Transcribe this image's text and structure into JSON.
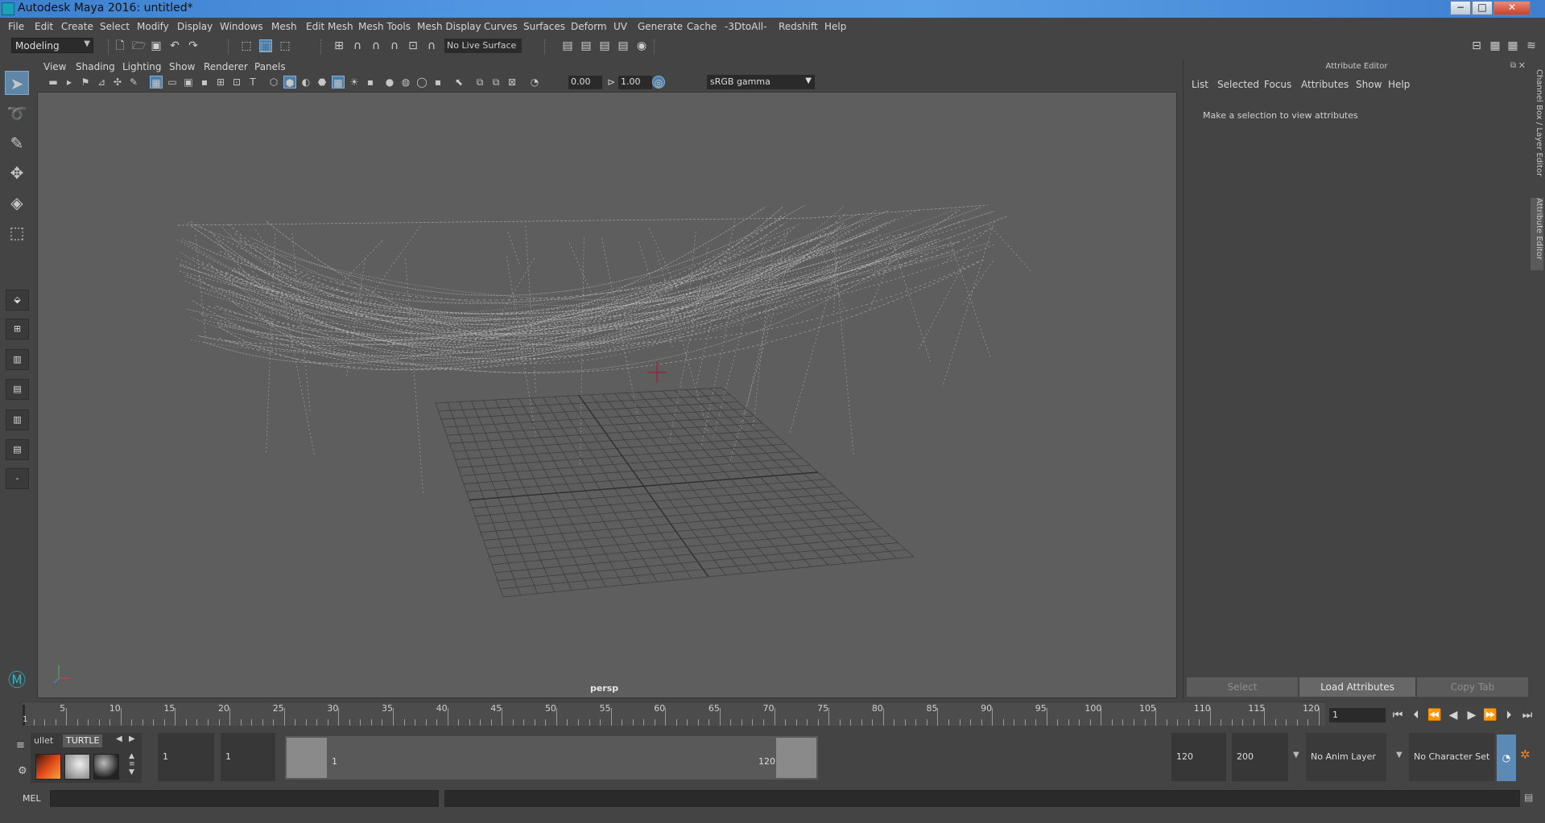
{
  "window": {
    "title": "Autodesk Maya 2016: untitled*",
    "min": "−",
    "max": "□",
    "close": "✕"
  },
  "menus": [
    "File",
    "Edit",
    "Create",
    "Select",
    "Modify",
    "Display",
    "Windows",
    "Mesh",
    "Edit Mesh",
    "Mesh Tools",
    "Mesh Display",
    "Curves",
    "Surfaces",
    "Deform",
    "UV",
    "Generate",
    "Cache",
    "-3DtoAll-",
    "Redshift",
    "Help"
  ],
  "status": {
    "mode": "Modeling",
    "live_surface": "No Live Surface"
  },
  "panel": {
    "menus": [
      "View",
      "Shading",
      "Lighting",
      "Show",
      "Renderer",
      "Panels"
    ],
    "exposure": "0.00",
    "gamma_value": "1.00",
    "color_space": "sRGB gamma",
    "camera": "persp"
  },
  "attribute_editor": {
    "header": "Attribute Editor",
    "menus": [
      "List",
      "Selected",
      "Focus",
      "Attributes",
      "Show",
      "Help"
    ],
    "message": "Make a selection to view attributes",
    "buttons": {
      "select": "Select",
      "load": "Load Attributes",
      "copy": "Copy Tab"
    }
  },
  "side_tabs": {
    "channel_box": "Channel Box / Layer Editor",
    "attribute_editor": "Attribute Editor"
  },
  "timeline": {
    "ticks": [
      "5",
      "10",
      "15",
      "20",
      "25",
      "30",
      "35",
      "40",
      "45",
      "50",
      "55",
      "60",
      "65",
      "70",
      "75",
      "80",
      "85",
      "90",
      "95",
      "100",
      "105",
      "110",
      "115",
      "120"
    ],
    "current_marker": "1",
    "current_frame": "1"
  },
  "range": {
    "shelf_tabs": {
      "left": "ullet",
      "active": "TURTLE"
    },
    "start": "1",
    "playback_start": "1",
    "range_start_label": "1",
    "range_end_label": "120",
    "playback_end": "120",
    "end": "200",
    "anim_layer": "No Anim Layer",
    "character_set": "No Character Set"
  },
  "command": {
    "mel_label": "MEL"
  }
}
